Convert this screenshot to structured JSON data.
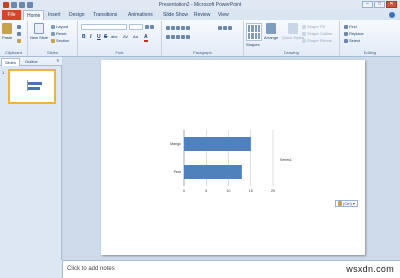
{
  "window": {
    "title": "Presentation2 - Microsoft PowerPoint",
    "controls": {
      "minimize": "–",
      "maximize": "□",
      "close": "✕"
    }
  },
  "tabs": {
    "file": "File",
    "items": [
      "Home",
      "Insert",
      "Design",
      "Transitions",
      "Animations",
      "Slide Show",
      "Review",
      "View"
    ],
    "active": "Home"
  },
  "ribbon": {
    "clipboard": {
      "label": "Clipboard",
      "paste": "Paste"
    },
    "slides": {
      "label": "Slides",
      "new_slide": "New Slide",
      "layout": "Layout",
      "reset": "Reset",
      "section": "Section"
    },
    "font": {
      "label": "Font",
      "bold": "B",
      "italic": "I",
      "underline": "U",
      "strike": "S",
      "shadow": "abc",
      "spacing": "AV",
      "case": "Aa",
      "color": "A"
    },
    "paragraph": {
      "label": "Paragraph"
    },
    "drawing": {
      "label": "Drawing",
      "shapes": "Shapes",
      "arrange": "Arrange",
      "quick_styles": "Quick Styles",
      "shape_fill": "Shape Fill",
      "shape_outline": "Shape Outline",
      "shape_effects": "Shape Effects"
    },
    "editing": {
      "label": "Editing",
      "find": "Find",
      "replace": "Replace",
      "select": "Select"
    }
  },
  "left_panel": {
    "tabs": [
      "Slides",
      "Outline"
    ],
    "close": "x",
    "slide_number": "1"
  },
  "chart_data": {
    "type": "bar",
    "orientation": "horizontal",
    "categories": [
      "Mango",
      "Pear"
    ],
    "values": [
      15,
      13
    ],
    "xticks": [
      "0",
      "5",
      "10",
      "15",
      "20"
    ],
    "xlim": [
      0,
      20
    ],
    "legend": [
      "Series1"
    ],
    "legend_position": "right",
    "grid": true,
    "bar_color": "#4f81bd"
  },
  "paste_options": {
    "label": "(Ctrl)"
  },
  "notes": {
    "placeholder": "Click to add notes"
  },
  "watermark": "wsxdn.com"
}
